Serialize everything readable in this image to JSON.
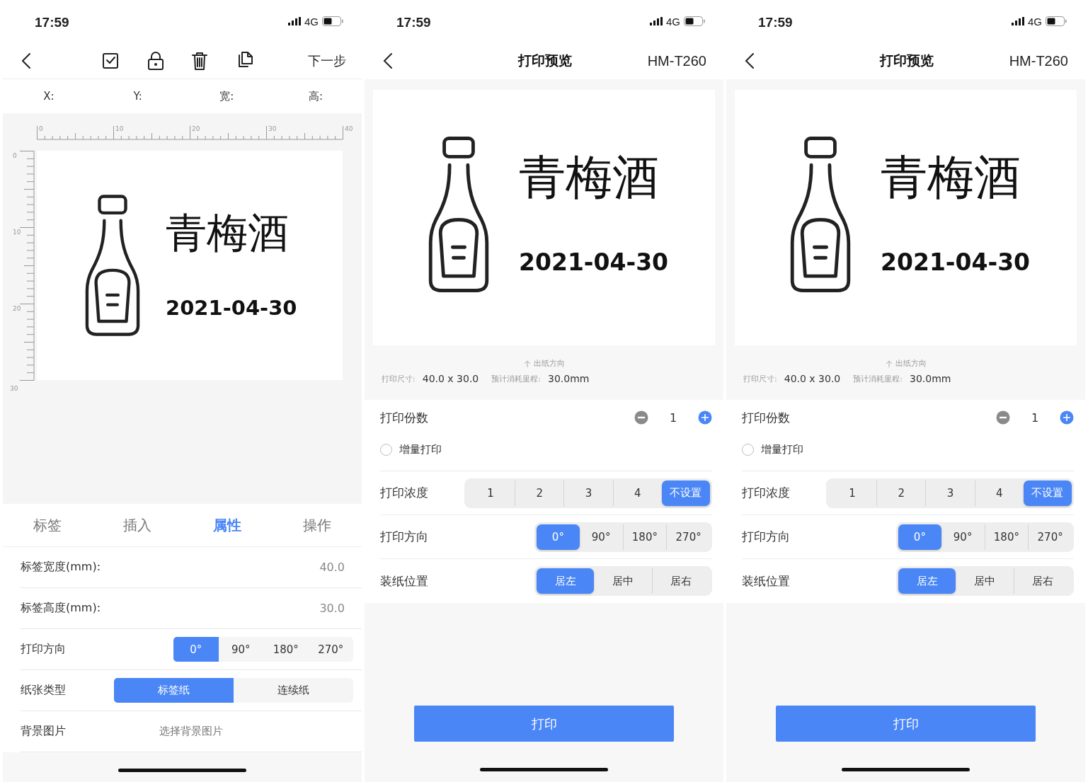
{
  "screens": [
    {
      "kind": "editor",
      "status_bar": {
        "time": "17:59",
        "network": "4G"
      },
      "nav": {
        "next": "下一步"
      },
      "coords": [
        "X:",
        "Y:",
        "宽:",
        "高:"
      ],
      "ruler": {
        "horizontal": [
          "0",
          "10",
          "20",
          "30",
          "40"
        ],
        "vertical": [
          "0",
          "10",
          "20",
          "30"
        ]
      },
      "label": {
        "title": "青梅酒",
        "date": "2021-04-30"
      },
      "tabs": [
        {
          "label": "标签",
          "selected": false
        },
        {
          "label": "插入",
          "selected": false
        },
        {
          "label": "属性",
          "selected": true
        },
        {
          "label": "操作",
          "selected": false
        }
      ],
      "properties": [
        {
          "kind": "value",
          "label": "标签宽度(mm):",
          "value": "40.0"
        },
        {
          "kind": "value",
          "label": "标签高度(mm):",
          "value": "30.0"
        },
        {
          "kind": "segmented",
          "label": "打印方向",
          "options": [
            {
              "label": "0°",
              "selected": true
            },
            {
              "label": "90°",
              "selected": false
            },
            {
              "label": "180°",
              "selected": false
            },
            {
              "label": "270°",
              "selected": false
            }
          ]
        },
        {
          "kind": "segmented",
          "label": "纸张类型",
          "options": [
            {
              "label": "标签纸",
              "selected": true
            },
            {
              "label": "连续纸",
              "selected": false
            }
          ]
        },
        {
          "kind": "picker",
          "label": "背景图片",
          "value": "选择背景图片"
        }
      ]
    },
    {
      "kind": "preview",
      "status_bar": {
        "time": "17:59",
        "network": "4G"
      },
      "nav": {
        "title": "打印预览",
        "printer": "HM-T260"
      },
      "label": {
        "title": "青梅酒",
        "date": "2021-04-30"
      },
      "feed_direction": "出纸方向",
      "size_label": "打印尺寸:",
      "size": "40.0 x 30.0",
      "length_label": "预计消耗里程:",
      "length": "30.0mm",
      "copies": {
        "label": "打印份数",
        "value": "1"
      },
      "incremental": {
        "label": "增量打印",
        "checked": false
      },
      "settings": [
        {
          "label": "打印浓度",
          "options": [
            {
              "label": "1",
              "selected": false
            },
            {
              "label": "2",
              "selected": false
            },
            {
              "label": "3",
              "selected": false
            },
            {
              "label": "4",
              "selected": false
            },
            {
              "label": "不设置",
              "selected": true
            }
          ]
        },
        {
          "label": "打印方向",
          "options": [
            {
              "label": "0°",
              "selected": true
            },
            {
              "label": "90°",
              "selected": false
            },
            {
              "label": "180°",
              "selected": false
            },
            {
              "label": "270°",
              "selected": false
            }
          ]
        },
        {
          "label": "装纸位置",
          "options": [
            {
              "label": "居左",
              "selected": true
            },
            {
              "label": "居中",
              "selected": false
            },
            {
              "label": "居右",
              "selected": false
            }
          ]
        }
      ],
      "print_button": "打印"
    },
    {
      "kind": "preview",
      "status_bar": {
        "time": "17:59",
        "network": "4G"
      },
      "nav": {
        "title": "打印预览",
        "printer": "HM-T260"
      },
      "label": {
        "title": "青梅酒",
        "date": "2021-04-30"
      },
      "feed_direction": "出纸方向",
      "size_label": "打印尺寸:",
      "size": "40.0 x 30.0",
      "length_label": "预计消耗里程:",
      "length": "30.0mm",
      "copies": {
        "label": "打印份数",
        "value": "1"
      },
      "incremental": {
        "label": "增量打印",
        "checked": false
      },
      "settings": [
        {
          "label": "打印浓度",
          "options": [
            {
              "label": "1",
              "selected": false
            },
            {
              "label": "2",
              "selected": false
            },
            {
              "label": "3",
              "selected": false
            },
            {
              "label": "4",
              "selected": false
            },
            {
              "label": "不设置",
              "selected": true
            }
          ]
        },
        {
          "label": "打印方向",
          "options": [
            {
              "label": "0°",
              "selected": true
            },
            {
              "label": "90°",
              "selected": false
            },
            {
              "label": "180°",
              "selected": false
            },
            {
              "label": "270°",
              "selected": false
            }
          ]
        },
        {
          "label": "装纸位置",
          "options": [
            {
              "label": "居左",
              "selected": true
            },
            {
              "label": "居中",
              "selected": false
            },
            {
              "label": "居右",
              "selected": false
            }
          ]
        }
      ],
      "print_button": "打印"
    }
  ]
}
